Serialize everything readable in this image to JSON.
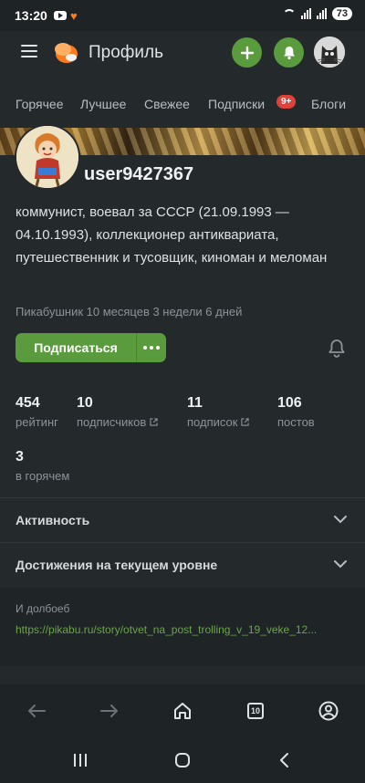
{
  "status": {
    "time": "13:20",
    "battery": "73"
  },
  "appbar": {
    "title": "Профиль"
  },
  "tabs": [
    {
      "label": "Горячее"
    },
    {
      "label": "Лучшее"
    },
    {
      "label": "Свежее"
    },
    {
      "label": "Подписки"
    },
    {
      "label": "Блоги"
    }
  ],
  "tabs_badge": "9+",
  "profile": {
    "username": "user9427367",
    "bio": "коммунист, воевал за СССР (21.09.1993 — 04.10.1993), коллекционер антиквариата, путешественник и тусовщик, киноман и меломан",
    "member_since": "Пикабушник 10 месяцев 3 недели 6 дней",
    "subscribe_label": "Подписаться"
  },
  "stats": [
    {
      "value": "454",
      "label": "рейтинг"
    },
    {
      "value": "10",
      "label": "подписчиков"
    },
    {
      "value": "11",
      "label": "подписок"
    },
    {
      "value": "106",
      "label": "постов"
    },
    {
      "value": "3",
      "label": "в горячем"
    }
  ],
  "sections": {
    "activity": "Активность",
    "achievements": "Достижения на текущем уровне"
  },
  "comment": {
    "author": "И долбоеб",
    "link": "https://pikabu.ru/story/otvet_na_post_trolling_v_19_veke_12..."
  },
  "bottom_nav": {
    "tabs_count": "10"
  },
  "colors": {
    "accent": "#5a9b3d",
    "badge": "#e0413a",
    "background": "#24292c"
  }
}
